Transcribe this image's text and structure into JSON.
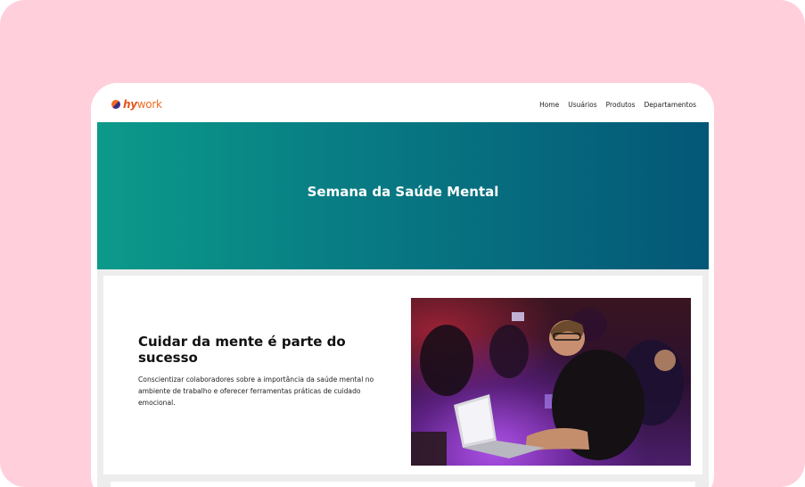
{
  "brand": {
    "logo_prefix": "hy",
    "logo_suffix": "work"
  },
  "nav": {
    "items": [
      "Home",
      "Usuários",
      "Produtos",
      "Departamentos"
    ]
  },
  "hero": {
    "title": "Semana da Saúde Mental"
  },
  "card": {
    "title": "Cuidar da mente é parte do sucesso",
    "description": "Conscientizar colaboradores sobre a importância da saúde mental no ambiente de trabalho e oferecer ferramentas práticas de cuidado emocional."
  },
  "colors": {
    "background": "#ffcfdc",
    "hero_start": "#0c9a8a",
    "hero_end": "#045777",
    "brand": "#e25517"
  }
}
